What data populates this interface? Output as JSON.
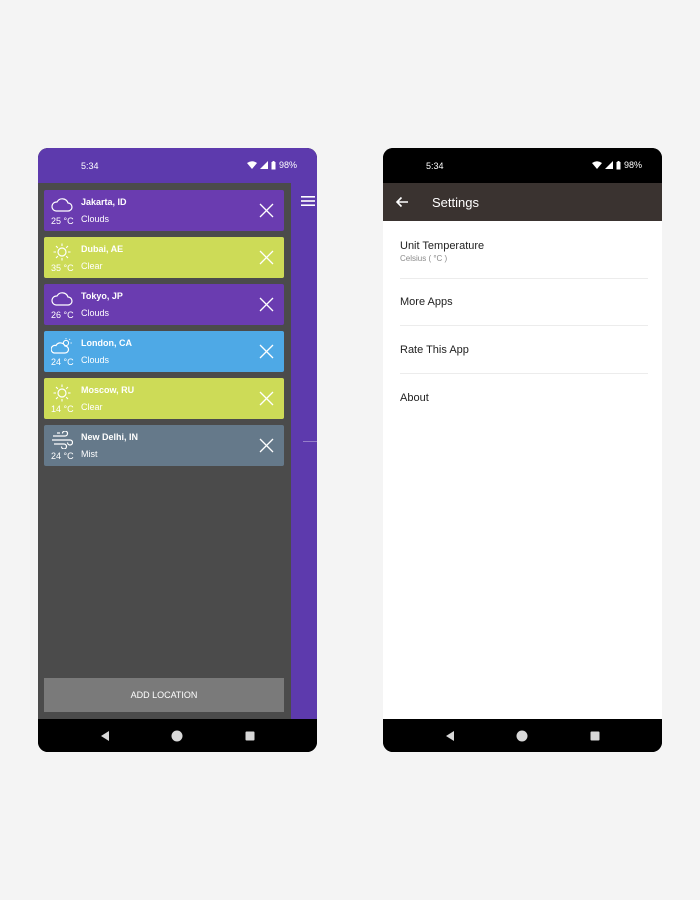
{
  "left_phone": {
    "status": {
      "time": "5:34",
      "battery": "98%"
    },
    "locations": [
      {
        "city": "Jakarta, ID",
        "temp": "25 °C",
        "condition": "Clouds",
        "icon": "cloud-icon",
        "color": "#6a3cb0"
      },
      {
        "city": "Dubai, AE",
        "temp": "35 °C",
        "condition": "Clear",
        "icon": "sun-icon",
        "color": "#cddb57"
      },
      {
        "city": "Tokyo, JP",
        "temp": "26 °C",
        "condition": "Clouds",
        "icon": "cloud-icon",
        "color": "#6a3cb0"
      },
      {
        "city": "London, CA",
        "temp": "24 °C",
        "condition": "Clouds",
        "icon": "cloud-sun-icon",
        "color": "#4ea9e6"
      },
      {
        "city": "Moscow, RU",
        "temp": "14 °C",
        "condition": "Clear",
        "icon": "sun-icon",
        "color": "#cddb57"
      },
      {
        "city": "New Delhi, IN",
        "temp": "24 °C",
        "condition": "Mist",
        "icon": "wind-icon",
        "color": "#65798a"
      }
    ],
    "add_location_label": "ADD LOCATION"
  },
  "right_phone": {
    "status": {
      "time": "5:34",
      "battery": "98%"
    },
    "appbar_title": "Settings",
    "settings": [
      {
        "label": "Unit Temperature",
        "sub": "Celsius ( °C )"
      },
      {
        "label": "More Apps"
      },
      {
        "label": "Rate This App"
      },
      {
        "label": "About"
      }
    ]
  }
}
